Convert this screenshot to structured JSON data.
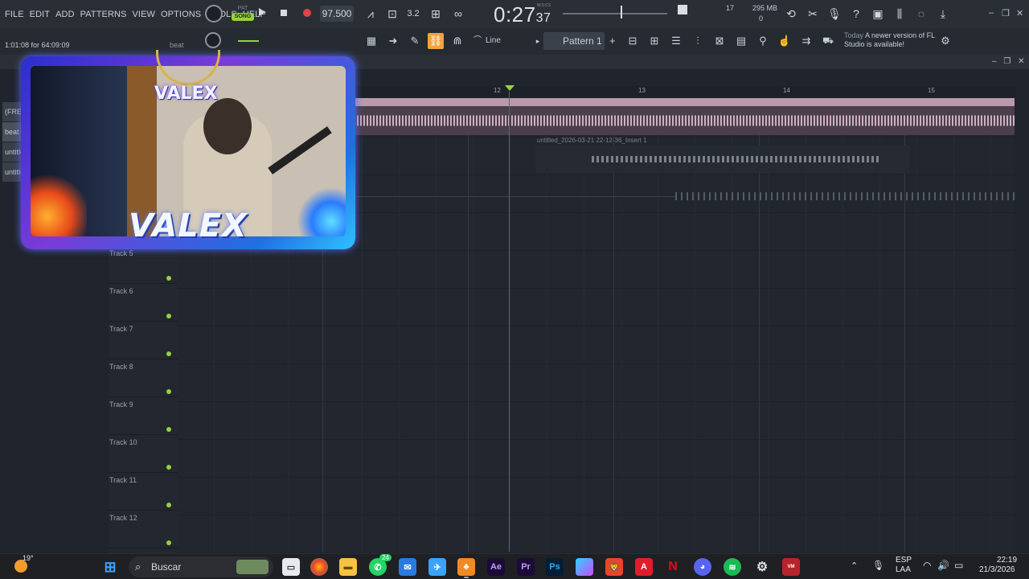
{
  "menu": [
    "FILE",
    "EDIT",
    "ADD",
    "PATTERNS",
    "VIEW",
    "OPTIONS",
    "TOOLS",
    "HELP"
  ],
  "transport": {
    "pat_label": "PAT",
    "song_label": "SONG",
    "tempo": "97.500",
    "time_main": "0:27",
    "time_sub": "37",
    "time_unit": "M:S:CS"
  },
  "stats": {
    "cpu_value": "17",
    "memory": "295 MB",
    "voices": "0"
  },
  "hint": {
    "position": "1:01:08 for 64:09:09",
    "target": "beat"
  },
  "toolbar2": {
    "snap_mode": "Line",
    "pattern": "Pattern 1",
    "plus": "+"
  },
  "news": {
    "when": "Today",
    "message": "A newer version of FL Studio is available!"
  },
  "ruler": [
    "12",
    "13",
    "14",
    "15"
  ],
  "clips": {
    "audio2_label": "untitled_2026-03-21 22-12-36_Insert 1"
  },
  "browser_items": [
    "(FREE F",
    "beat",
    "untitled",
    "untitled"
  ],
  "tracks": [
    "Track 5",
    "Track 6",
    "Track 7",
    "Track 8",
    "Track 9",
    "Track 10",
    "Track 11",
    "Track 12"
  ],
  "overlay": {
    "brand_small": "VALEX",
    "brand_large": "VALEX"
  },
  "taskbar": {
    "weather_temp": "19°",
    "search_placeholder": "Buscar",
    "whatsapp_badge": "24",
    "lang_top": "ESP",
    "lang_bottom": "LAA",
    "clock_time": "22:19",
    "clock_date": "21/3/2026"
  },
  "colors": {
    "accent_green": "#95d23a",
    "record_red": "#e24545",
    "active_orange": "#f0a43a",
    "clip_pink": "#b89aaa"
  }
}
